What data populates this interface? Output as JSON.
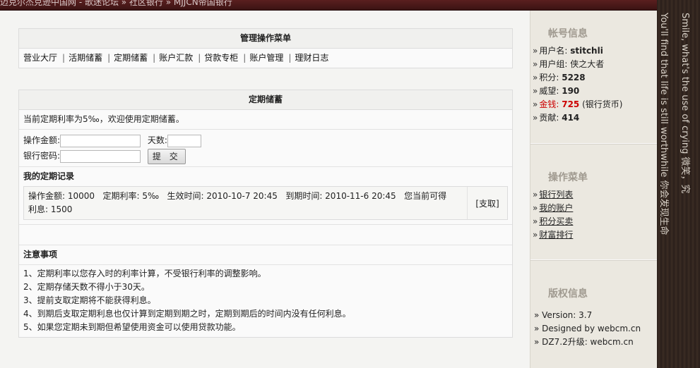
{
  "topbar": {
    "breadcrumb": "迈克尔杰克逊中国网 - 歌迷论坛  » 社区银行  » MJJCN帝国银行"
  },
  "admin_menu": {
    "title": "管理操作菜单",
    "items": [
      "营业大厅",
      "活期储蓄",
      "定期储蓄",
      "账户汇款",
      "贷款专柜",
      "账户管理",
      "理财日志"
    ],
    "separator": "|"
  },
  "fixed_deposit": {
    "title": "定期储蓄",
    "intro": "当前定期利率为5‰，欢迎使用定期储蓄。",
    "amount_label": "操作金额:",
    "days_label": "天数:",
    "password_label": "银行密码:",
    "submit_label": "提 交",
    "records_title": "我的定期记录",
    "record": {
      "line1": "操作金额: 10000   定期利率: 5‰   生效时间: 2010-10-7 20:45   到期时间: 2010-11-6 20:45   您当前可得",
      "line2": "利息: 1500",
      "action": "[支取]"
    }
  },
  "notes": {
    "title": "注意事项",
    "items": [
      "1、定期利率以您存入时的利率计算，不受银行利率的调整影响。",
      "2、定期存储天数不得小于30天。",
      "3、提前支取定期将不能获得利息。",
      "4、到期后支取定期利息也仅计算到定期到期之时，定期到期后的时间内没有任何利息。",
      "5、如果您定期未到期但希望使用资金可以使用贷款功能。"
    ]
  },
  "sidebar": {
    "account": {
      "title": "帐号信息",
      "username_label": "用户名:",
      "username": "stitchli",
      "group_label": "用户组:",
      "group": "侠之大者",
      "points_label": "积分:",
      "points": "5228",
      "prestige_label": "威望:",
      "prestige": "190",
      "money_label": "金钱:",
      "money": "725",
      "money_unit": "(银行货币)",
      "contribution_label": "贡献:",
      "contribution": "414"
    },
    "ops": {
      "title": "操作菜单",
      "items": [
        "银行列表",
        "我的账户",
        "积分买卖",
        "财富排行"
      ]
    },
    "copyright": {
      "title": "版权信息",
      "lines": [
        "» Version: 3.7",
        "» Designed by webcm.cn",
        "» DZ7.2升级: webcm.cn"
      ]
    }
  },
  "right_strip": {
    "lines": [
      "Smile, what's the use of crying  微笑，究",
      "You'll find that life is still worthwhile 你会发现生命"
    ]
  },
  "colors": {
    "money_red": "#cc0000",
    "topbar_bg": "#4a1818",
    "main_bg": "#f4f4f2",
    "sidebar_bg": "#ebe8e0"
  }
}
